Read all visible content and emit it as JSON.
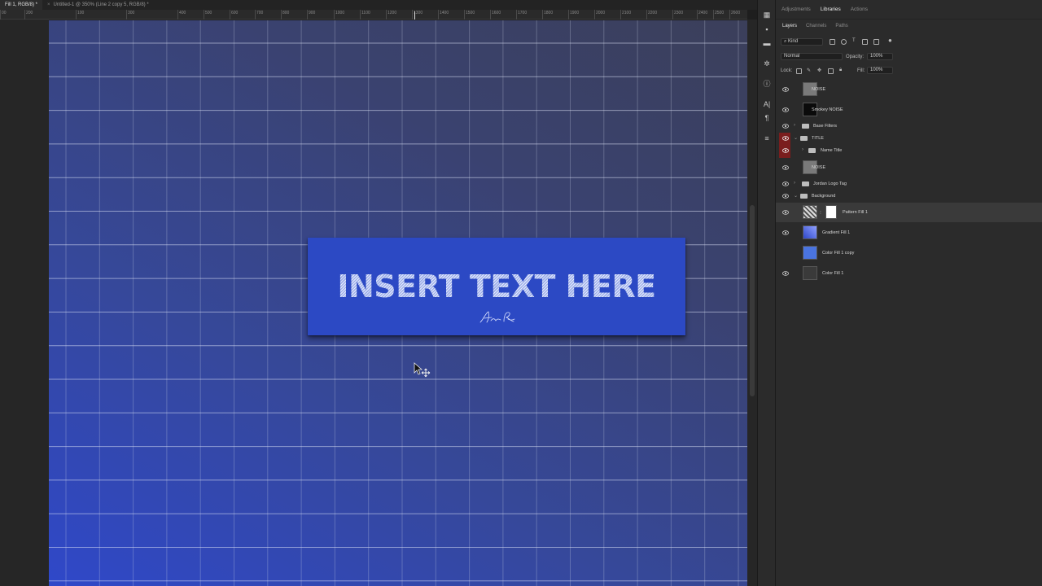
{
  "document_tabs": [
    {
      "label": "Fill 1, RGB/8) *",
      "active": true
    },
    {
      "label": "Untitled-1 @ 350% (Line 2 copy 5, RGB/8) *",
      "active": false
    }
  ],
  "ruler": {
    "ticks": [
      "00",
      "200",
      "100",
      "300",
      "400",
      "500",
      "600",
      "700",
      "800",
      "900",
      "1000",
      "1100",
      "1200",
      "1300",
      "1400",
      "1500",
      "1600",
      "1700",
      "1800",
      "1900",
      "2000",
      "2100",
      "2200",
      "2300",
      "2400",
      "2500",
      "2600"
    ]
  },
  "canvas": {
    "title": "INSERT TEXT HERE",
    "gradient": [
      "#2f48c9",
      "#3b3f5a"
    ],
    "card_color": "#2c49c4"
  },
  "panel": {
    "top_tabs": [
      "Adjustments",
      "Libraries",
      "Actions"
    ],
    "active_top_tab": "Libraries",
    "sub_tabs": [
      "Layers",
      "Channels",
      "Paths"
    ],
    "active_sub_tab": "Layers",
    "filter": {
      "label": "Kind"
    },
    "blend_mode": "Normal",
    "opacity_label": "Opacity:",
    "opacity_value": "100%",
    "lock_label": "Lock:",
    "fill_label": "Fill:",
    "fill_value": "100%"
  },
  "layers": [
    {
      "name": "NOISE",
      "type": "layer",
      "thumb": "#7a7a7a"
    },
    {
      "name": "Smokey NOISE",
      "type": "layer",
      "thumb": "#0b0b0b"
    },
    {
      "name": "Base Filters",
      "type": "group"
    },
    {
      "name": "TITLE",
      "type": "group-open"
    },
    {
      "name": "Name Title",
      "type": "group"
    },
    {
      "name": "NOISE",
      "type": "layer",
      "thumb": "#7a7a7a"
    },
    {
      "name": "Jordan Logo Tag",
      "type": "group"
    },
    {
      "name": "Background",
      "type": "group-open"
    },
    {
      "name": "Pattern Fill 1",
      "type": "fill"
    },
    {
      "name": "Gradient Fill 1",
      "type": "fill"
    },
    {
      "name": "Color Fill 1 copy",
      "type": "fill"
    },
    {
      "name": "Color Fill 1",
      "type": "fill"
    }
  ],
  "tools": [
    "layers-panel-icon",
    "libraries-icon",
    "comments-icon",
    "color-icon",
    "info-icon",
    "character-icon",
    "paragraph-icon",
    "properties-icon"
  ],
  "accent_colors": {
    "visibility_red": "#7a1e1e",
    "panel_bg": "#2b2b2b"
  }
}
